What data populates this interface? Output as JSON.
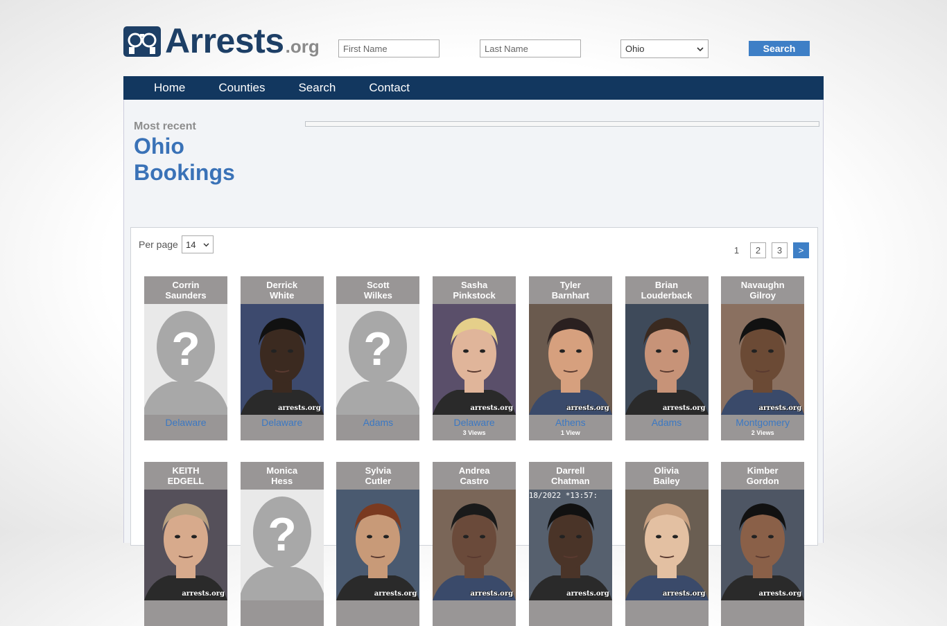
{
  "logo": {
    "main": "Arrests",
    "suffix": ".org"
  },
  "search": {
    "first_placeholder": "First Name",
    "last_placeholder": "Last Name",
    "state": "Ohio",
    "button": "Search"
  },
  "nav": {
    "home": "Home",
    "counties": "Counties",
    "search": "Search",
    "contact": "Contact"
  },
  "heading": {
    "kicker": "Most recent",
    "title_line1": "Ohio",
    "title_line2": "Bookings"
  },
  "listing": {
    "per_page_label": "Per page",
    "per_page_value": "14",
    "pages": [
      "1",
      "2",
      "3",
      ">"
    ]
  },
  "records": [
    {
      "first": "Corrin",
      "last": "Saunders",
      "county": "Delaware",
      "views": "",
      "photo": "placeholder-silhouette"
    },
    {
      "first": "Derrick",
      "last": "White",
      "county": "Delaware",
      "views": "",
      "photo": "mugshot"
    },
    {
      "first": "Scott",
      "last": "Wilkes",
      "county": "Adams",
      "views": "",
      "photo": "placeholder-silhouette"
    },
    {
      "first": "Sasha",
      "last": "Pinkstock",
      "county": "Delaware",
      "views": "3 Views",
      "photo": "mugshot"
    },
    {
      "first": "Tyler",
      "last": "Barnhart",
      "county": "Athens",
      "views": "1 View",
      "photo": "mugshot"
    },
    {
      "first": "Brian",
      "last": "Louderback",
      "county": "Adams",
      "views": "",
      "photo": "mugshot"
    },
    {
      "first": "Navaughn",
      "last": "Gilroy",
      "county": "Montgomery",
      "views": "2 Views",
      "photo": "mugshot"
    },
    {
      "first": "KEITH",
      "last": "EDGELL",
      "county": "",
      "views": "",
      "photo": "mugshot"
    },
    {
      "first": "Monica",
      "last": "Hess",
      "county": "",
      "views": "",
      "photo": "placeholder-silhouette"
    },
    {
      "first": "Sylvia",
      "last": "Cutler",
      "county": "",
      "views": "",
      "photo": "mugshot"
    },
    {
      "first": "Andrea",
      "last": "Castro",
      "county": "",
      "views": "",
      "photo": "mugshot"
    },
    {
      "first": "Darrell",
      "last": "Chatman",
      "county": "",
      "views": "",
      "photo": "mugshot",
      "overlay_text": "18/2022 *13:57:"
    },
    {
      "first": "Olivia",
      "last": "Bailey",
      "county": "",
      "views": "",
      "photo": "mugshot"
    },
    {
      "first": "Kimber",
      "last": "Gordon",
      "county": "",
      "views": "",
      "photo": "mugshot"
    }
  ],
  "watermark": "arrests.org",
  "colors": {
    "brand_navy": "#12375f",
    "accent_blue": "#3e7fc6",
    "link_blue": "#3b78c3",
    "card_gray": "#999696"
  }
}
